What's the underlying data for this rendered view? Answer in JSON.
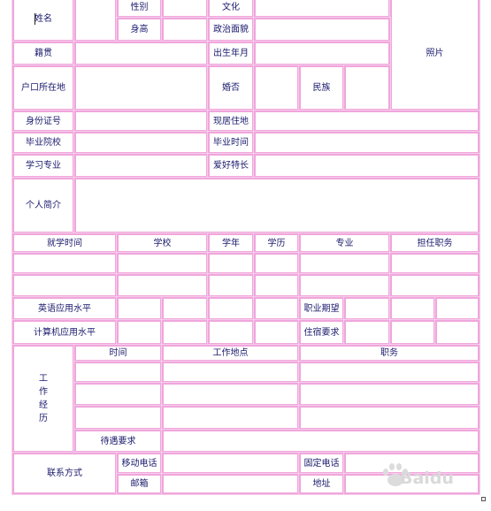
{
  "form": {
    "name_label": "姓名",
    "gender_label": "性别",
    "culture_label": "文化",
    "photo_label": "照片",
    "height_label": "身高",
    "politics_label": "政治面貌",
    "native_place_label": "籍贯",
    "birth_label": "出生年月",
    "hukou_label": "户口所在地",
    "marriage_label": "婚否",
    "ethnicity_label": "民族",
    "id_label": "身份证号",
    "residence_label": "现居住地",
    "school_label": "毕业院校",
    "grad_time_label": "毕业时间",
    "major_label": "学习专业",
    "hobby_label": "爱好特长",
    "intro_label": "个人简介",
    "education_headers": [
      "就学时间",
      "学校",
      "学年",
      "学历",
      "专业",
      "担任职务"
    ],
    "english_label": "英语应用水平",
    "job_expect_label": "职业期望",
    "computer_label": "计算机应用水平",
    "housing_label": "住宿要求",
    "work_label": "工作经历",
    "work_headers": [
      "时间",
      "工作地点",
      "职务"
    ],
    "salary_label": "待遇要求",
    "contact_label": "联系方式",
    "mobile_label": "移动电话",
    "landline_label": "固定电话",
    "email_label": "邮箱",
    "address_label": "地址"
  },
  "watermark": {
    "text": "Baidu",
    "icon": "paw-icon"
  },
  "colors": {
    "border": "#f0a6dc",
    "text": "#1b1b6e"
  }
}
